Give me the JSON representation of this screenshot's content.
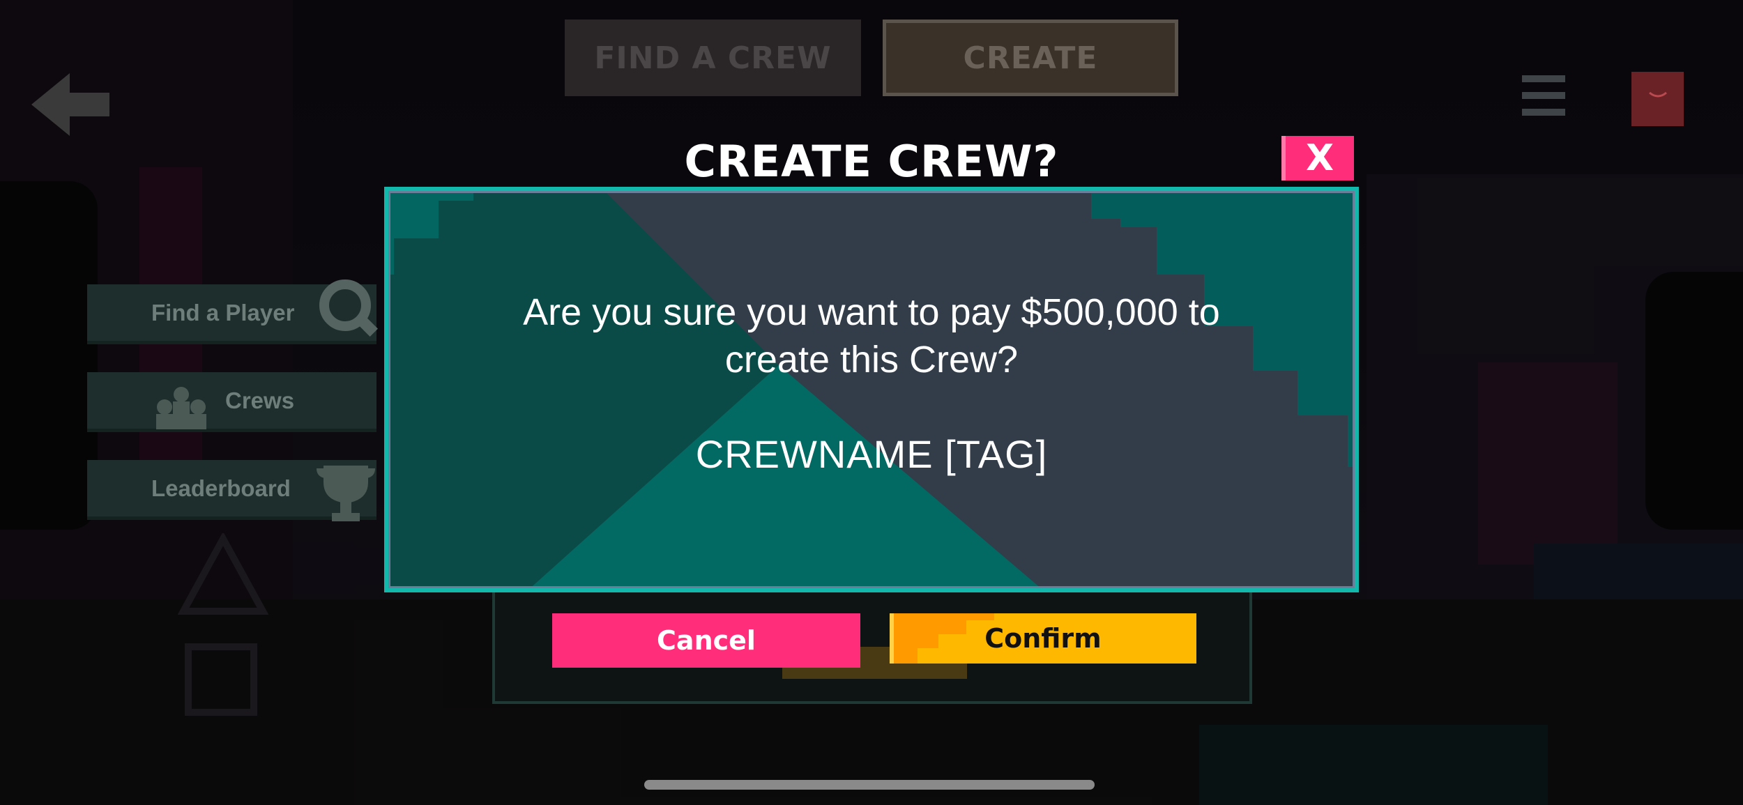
{
  "top_tabs": {
    "find_a_crew": "FIND A CREW",
    "create": "CREATE"
  },
  "side_menu": {
    "items": [
      {
        "label": "Find a Player",
        "icon": "magnifier-icon"
      },
      {
        "label": "Crews",
        "icon": "crew-people-icon"
      },
      {
        "label": "Leaderboard",
        "icon": "trophy-icon"
      }
    ]
  },
  "dialog": {
    "title": "CREATE CREW?",
    "close_label": "X",
    "message": "Are you sure you want to pay $500,000 to create this Crew?",
    "crew_name": "CREWNAME [TAG]",
    "cancel_label": "Cancel",
    "confirm_label": "Confirm"
  },
  "colors": {
    "accent_pink": "#ff2d7a",
    "accent_yellow": "#ffb800",
    "dialog_teal": "#13b8ad",
    "dialog_slate": "#333d4a"
  }
}
